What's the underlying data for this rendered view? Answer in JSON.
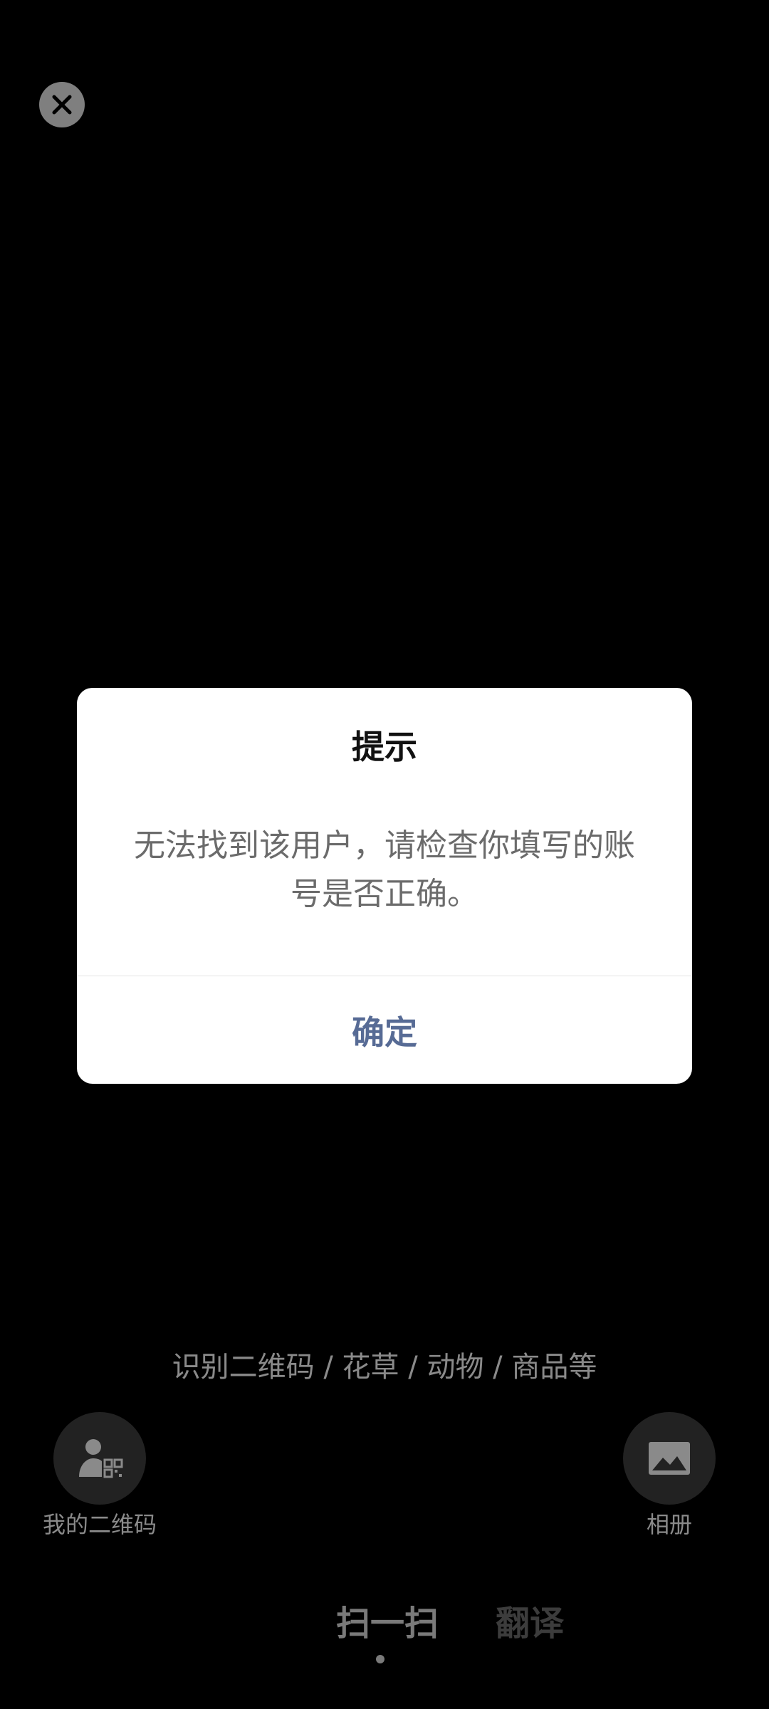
{
  "dialog": {
    "title": "提示",
    "message": "无法找到该用户，请检查你填写的账号是否正确。",
    "confirm_label": "确定"
  },
  "scan": {
    "hint": "识别二维码 / 花草 / 动物 / 商品等"
  },
  "actions": {
    "my_qr_label": "我的二维码",
    "album_label": "相册"
  },
  "tabs": [
    {
      "label": "扫一扫",
      "active": true
    },
    {
      "label": "翻译",
      "active": false
    }
  ],
  "icons": {
    "close": "close-icon",
    "my_qr": "user-qr-icon",
    "album": "image-icon"
  },
  "colors": {
    "background": "#000000",
    "dialog_bg": "#ffffff",
    "confirm_text": "#576b95"
  }
}
